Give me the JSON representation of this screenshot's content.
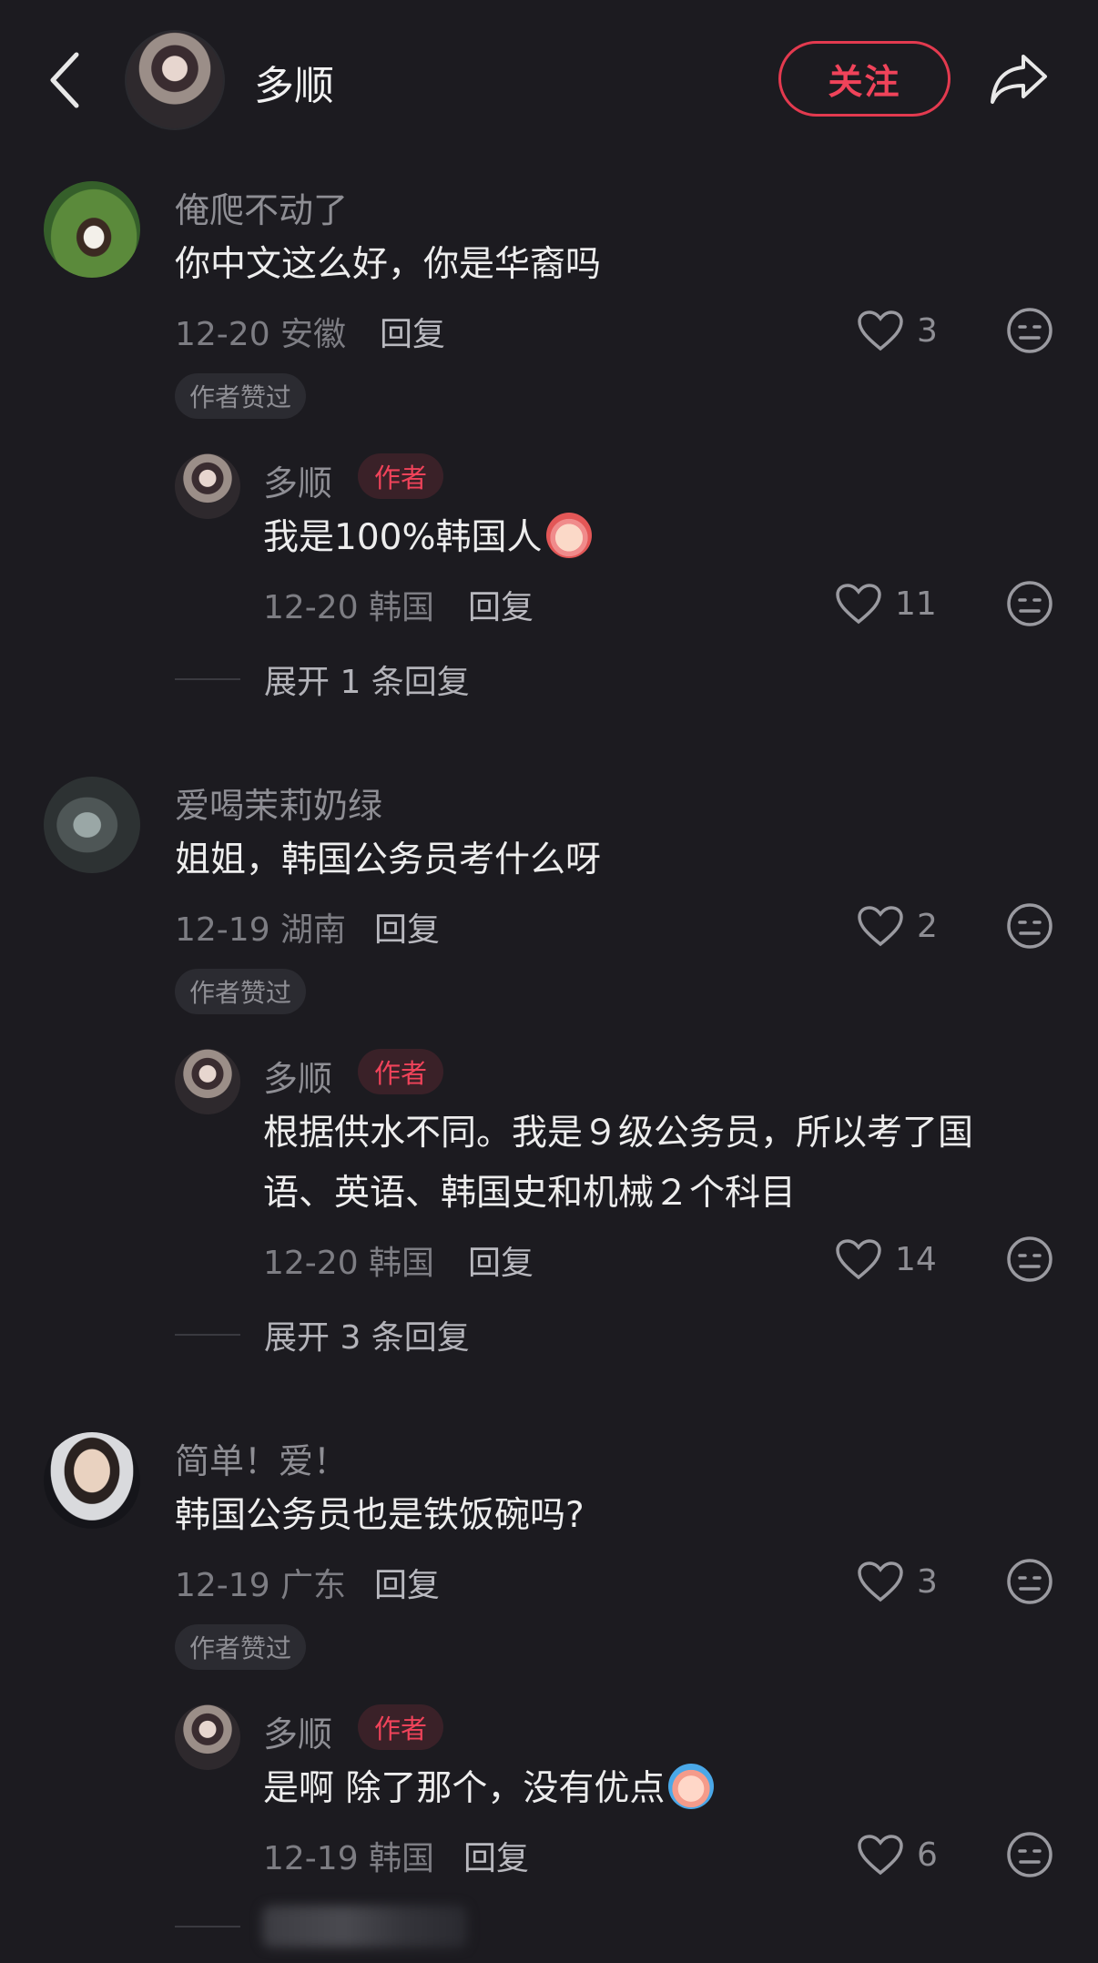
{
  "header": {
    "title": "多顺",
    "follow_label": "关注"
  },
  "comments": [
    {
      "username": "俺爬不动了",
      "text": "你中文这么好，你是华裔吗",
      "meta": "12-20 安徽",
      "reply_label": "回复",
      "likes": "3",
      "liked_by_author": "作者赞过",
      "author_reply": {
        "username": "多顺",
        "author_tag": "作者",
        "text": "我是100%韩国人",
        "meta": "12-20 韩国",
        "reply_label": "回复",
        "likes": "11"
      },
      "expand_label": "展开 1 条回复"
    },
    {
      "username": "爱喝茉莉奶绿",
      "text": "姐姐，韩国公务员考什么呀",
      "meta": "12-19 湖南",
      "reply_label": "回复",
      "likes": "2",
      "liked_by_author": "作者赞过",
      "author_reply": {
        "username": "多顺",
        "author_tag": "作者",
        "text_line1": "根据供水不同。我是９级公务员，所以考了国",
        "text_line2": "语、英语、韩国史和机械２个科目",
        "meta": "12-20 韩国",
        "reply_label": "回复",
        "likes": "14"
      },
      "expand_label": "展开 3 条回复"
    },
    {
      "username": "简单！爱！",
      "text": "韩国公务员也是铁饭碗吗?",
      "meta": "12-19 广东",
      "reply_label": "回复",
      "likes": "3",
      "liked_by_author": "作者赞过",
      "author_reply": {
        "username": "多顺",
        "author_tag": "作者",
        "text": "是啊 除了那个，没有优点",
        "meta": "12-19 韩国",
        "reply_label": "回复",
        "likes": "6"
      }
    }
  ],
  "icons": {
    "back": "chevron-left-icon",
    "share": "share-arrow-icon",
    "like": "heart-outline-icon",
    "dislike": "neutral-face-icon",
    "emoji_1": "shy-face-emoji",
    "emoji_2": "crying-face-emoji"
  },
  "colors": {
    "background": "#1c1b20",
    "accent": "#f0435a"
  }
}
